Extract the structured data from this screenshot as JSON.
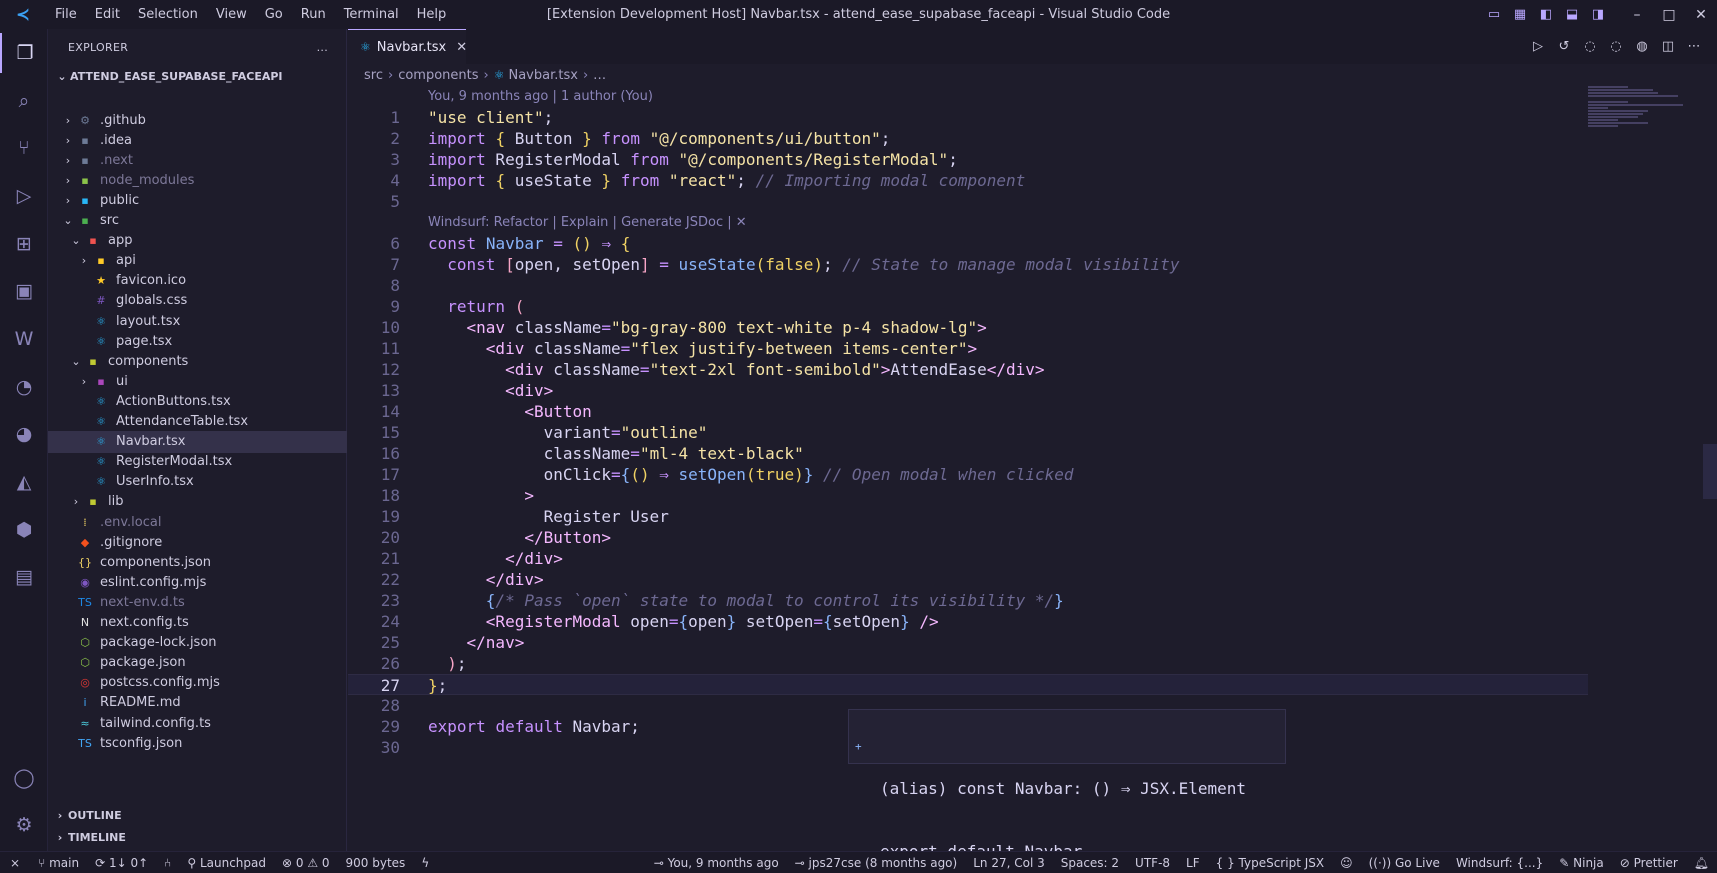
{
  "titlebar": {
    "menu": [
      "File",
      "Edit",
      "Selection",
      "View",
      "Go",
      "Run",
      "Terminal",
      "Help"
    ],
    "title": "[Extension Development Host] Navbar.tsx - attend_ease_supabase_faceapi - Visual Studio Code"
  },
  "activitybar": {
    "icons": [
      "explorer-icon",
      "search-icon",
      "source-control-icon",
      "run-debug-icon",
      "extensions-icon",
      "remote-explorer-icon",
      "windsurf-icon",
      "git-graph-icon",
      "docker-icon",
      "prisma-icon",
      "database-icon",
      "project-manager-icon",
      "account-icon",
      "settings-gear-icon"
    ]
  },
  "sidebar": {
    "header": "EXPLORER",
    "more": "...",
    "root": "ATTEND_EASE_SUPABASE_FACEAPI",
    "tree": [
      {
        "label": ".github",
        "chevron": "›",
        "icon": "⚙",
        "icon_color": "#6d7a96",
        "indent": 0
      },
      {
        "label": ".idea",
        "chevron": "›",
        "icon": "▪",
        "icon_color": "#6d7a96",
        "indent": 0
      },
      {
        "label": ".next",
        "chevron": "›",
        "icon": "▪",
        "icon_color": "#6d7a96",
        "indent": 0,
        "dim": true
      },
      {
        "label": "node_modules",
        "chevron": "›",
        "icon": "▪",
        "icon_color": "#8bc34a",
        "indent": 0,
        "dim": true
      },
      {
        "label": "public",
        "chevron": "›",
        "icon": "▪",
        "icon_color": "#29b6f6",
        "indent": 0
      },
      {
        "label": "src",
        "chevron": "⌄",
        "icon": "▪",
        "icon_color": "#4caf50",
        "indent": 0
      },
      {
        "label": "app",
        "chevron": "⌄",
        "icon": "▪",
        "icon_color": "#ef5350",
        "indent": 1
      },
      {
        "label": "api",
        "chevron": "›",
        "icon": "▪",
        "icon_color": "#ffca28",
        "indent": 2
      },
      {
        "label": "favicon.ico",
        "chevron": "",
        "icon": "★",
        "icon_color": "#ffca28",
        "indent": 2
      },
      {
        "label": "globals.css",
        "chevron": "",
        "icon": "#",
        "icon_color": "#7e57c2",
        "indent": 2
      },
      {
        "label": "layout.tsx",
        "chevron": "",
        "icon": "⚛",
        "icon_color": "#29b6f6",
        "indent": 2
      },
      {
        "label": "page.tsx",
        "chevron": "",
        "icon": "⚛",
        "icon_color": "#29b6f6",
        "indent": 2
      },
      {
        "label": "components",
        "chevron": "⌄",
        "icon": "▪",
        "icon_color": "#c0ca33",
        "indent": 1
      },
      {
        "label": "ui",
        "chevron": "›",
        "icon": "▪",
        "icon_color": "#ab47bc",
        "indent": 2
      },
      {
        "label": "ActionButtons.tsx",
        "chevron": "",
        "icon": "⚛",
        "icon_color": "#29b6f6",
        "indent": 2
      },
      {
        "label": "AttendanceTable.tsx",
        "chevron": "",
        "icon": "⚛",
        "icon_color": "#29b6f6",
        "indent": 2
      },
      {
        "label": "Navbar.tsx",
        "chevron": "",
        "icon": "⚛",
        "icon_color": "#29b6f6",
        "indent": 2,
        "selected": true
      },
      {
        "label": "RegisterModal.tsx",
        "chevron": "",
        "icon": "⚛",
        "icon_color": "#29b6f6",
        "indent": 2
      },
      {
        "label": "UserInfo.tsx",
        "chevron": "",
        "icon": "⚛",
        "icon_color": "#29b6f6",
        "indent": 2
      },
      {
        "label": "lib",
        "chevron": "›",
        "icon": "▪",
        "icon_color": "#c0ca33",
        "indent": 1
      },
      {
        "label": ".env.local",
        "chevron": "",
        "icon": "⁞",
        "icon_color": "#f0d264",
        "indent": 0,
        "dim": true
      },
      {
        "label": ".gitignore",
        "chevron": "",
        "icon": "◆",
        "icon_color": "#f4511e",
        "indent": 0
      },
      {
        "label": "components.json",
        "chevron": "",
        "icon": "{}",
        "icon_color": "#f0d264",
        "indent": 0
      },
      {
        "label": "eslint.config.mjs",
        "chevron": "",
        "icon": "◉",
        "icon_color": "#7e57c2",
        "indent": 0
      },
      {
        "label": "next-env.d.ts",
        "chevron": "",
        "icon": "TS",
        "icon_color": "#1e88e5",
        "indent": 0,
        "dim": true
      },
      {
        "label": "next.config.ts",
        "chevron": "",
        "icon": "N",
        "icon_color": "#e0e0e0",
        "indent": 0
      },
      {
        "label": "package-lock.json",
        "chevron": "",
        "icon": "⬡",
        "icon_color": "#8bc34a",
        "indent": 0
      },
      {
        "label": "package.json",
        "chevron": "",
        "icon": "⬡",
        "icon_color": "#8bc34a",
        "indent": 0
      },
      {
        "label": "postcss.config.mjs",
        "chevron": "",
        "icon": "◎",
        "icon_color": "#e53935",
        "indent": 0
      },
      {
        "label": "README.md",
        "chevron": "",
        "icon": "i",
        "icon_color": "#42a5f5",
        "indent": 0
      },
      {
        "label": "tailwind.config.ts",
        "chevron": "",
        "icon": "≈",
        "icon_color": "#4dd0e1",
        "indent": 0
      },
      {
        "label": "tsconfig.json",
        "chevron": "",
        "icon": "TS",
        "icon_color": "#42a5f5",
        "indent": 0
      }
    ],
    "outline": "OUTLINE",
    "timeline": "TIMELINE"
  },
  "editor": {
    "tab": {
      "label": "Navbar.tsx",
      "close": "✕"
    },
    "breadcrumb": [
      "src",
      "components",
      "Navbar.tsx",
      "…"
    ],
    "blame_lens": "You, 9 months ago | 1 author (You)",
    "codelens": "Windsurf: Refactor | Explain | Generate JSDoc | ✕",
    "current_line": 27,
    "line_numbers": [
      "1",
      "2",
      "3",
      "4",
      "5",
      "6",
      "7",
      "8",
      "9",
      "10",
      "11",
      "12",
      "13",
      "14",
      "15",
      "16",
      "17",
      "18",
      "19",
      "20",
      "21",
      "22",
      "23",
      "24",
      "25",
      "26",
      "27",
      "28",
      "29",
      "30"
    ],
    "hover": {
      "line1": "(alias) const Navbar: () ⇒ JSX.Element",
      "line2": "export default Navbar"
    }
  },
  "statusbar": {
    "remote": "⨯",
    "branch": "main",
    "sync": "1↓ 0↑",
    "launchpad": "Launchpad",
    "problems": "⊗ 0 ⚠ 0",
    "size": "900 bytes",
    "blame": "You, 9 months ago",
    "commit": "jps27cse (8 months ago)",
    "position": "Ln 27, Col 3",
    "spaces": "Spaces: 2",
    "encoding": "UTF-8",
    "eol": "LF",
    "language": "TypeScript JSX",
    "golive": "Go Live",
    "windsurf": "Windsurf: {...}",
    "ninja": "Ninja",
    "prettier": "Prettier"
  }
}
